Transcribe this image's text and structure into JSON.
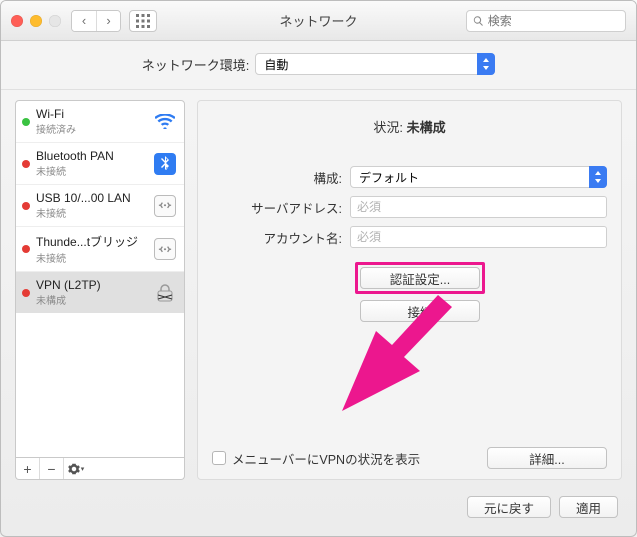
{
  "window": {
    "title": "ネットワーク"
  },
  "search": {
    "placeholder": "検索"
  },
  "location": {
    "label": "ネットワーク環境:",
    "value": "自動"
  },
  "services": [
    {
      "name": "Wi-Fi",
      "status": "接続済み",
      "dot": "green",
      "icon": "wifi",
      "selected": false
    },
    {
      "name": "Bluetooth PAN",
      "status": "未接続",
      "dot": "red",
      "icon": "bt",
      "selected": false
    },
    {
      "name": "USB 10/...00 LAN",
      "status": "未接続",
      "dot": "red",
      "icon": "eth",
      "selected": false
    },
    {
      "name": "Thunde...tブリッジ",
      "status": "未接続",
      "dot": "red",
      "icon": "eth",
      "selected": false
    },
    {
      "name": "VPN (L2TP)",
      "status": "未構成",
      "dot": "red",
      "icon": "vpn",
      "selected": true
    }
  ],
  "panel": {
    "status_label": "状況:",
    "status_value": "未構成",
    "config_label": "構成:",
    "config_value": "デフォルト",
    "server_label": "サーバアドレス:",
    "server_placeholder": "必須",
    "account_label": "アカウント名:",
    "account_placeholder": "必須",
    "auth_button": "認証設定...",
    "connect_button": "接続",
    "menubar_checkbox": "メニューバーにVPNの状況を表示",
    "advanced_button": "詳細..."
  },
  "footer": {
    "revert": "元に戻す",
    "apply": "適用"
  },
  "highlight_color": "#ec178e"
}
